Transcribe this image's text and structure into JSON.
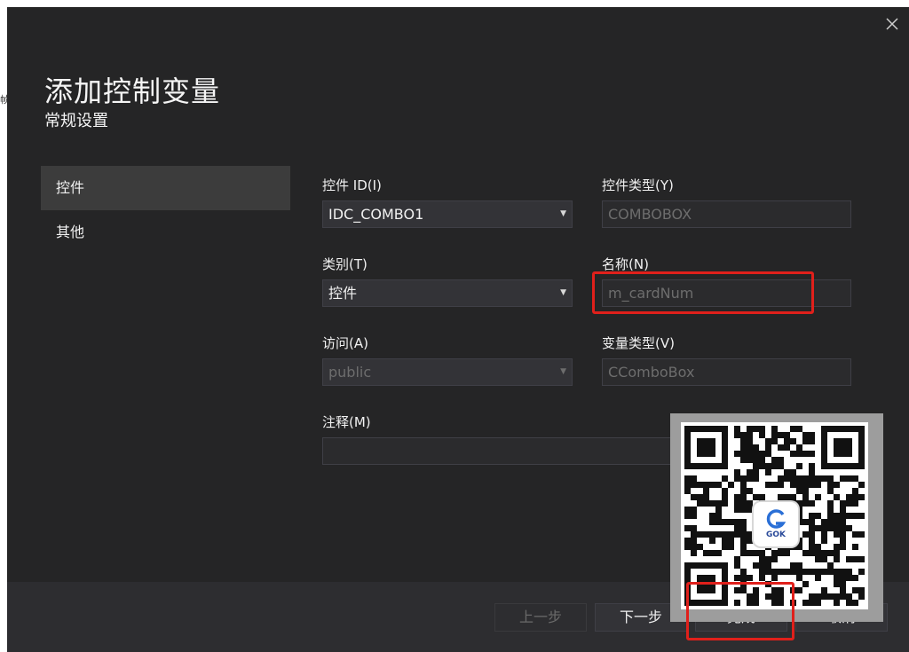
{
  "background": {
    "left_glyph": "帧"
  },
  "dialog": {
    "title": "添加控制变量",
    "subtitle": "常规设置",
    "close_icon": "close-icon"
  },
  "nav": {
    "items": [
      {
        "label": "控件",
        "active": true
      },
      {
        "label": "其他",
        "active": false
      }
    ]
  },
  "form": {
    "control_id": {
      "label": "控件 ID(I)",
      "value": "IDC_COMBO1"
    },
    "control_type": {
      "label": "控件类型(Y)",
      "value": "COMBOBOX"
    },
    "category": {
      "label": "类别(T)",
      "value": "控件"
    },
    "name": {
      "label": "名称(N)",
      "value": "m_cardNum"
    },
    "access": {
      "label": "访问(A)",
      "value": "public"
    },
    "variable_type": {
      "label": "变量类型(V)",
      "value": "CComboBox"
    },
    "comment": {
      "label": "注释(M)",
      "value": ""
    }
  },
  "buttons": {
    "prev": "上一步",
    "next": "下一步",
    "finish": "完成",
    "cancel": "取消"
  },
  "overlay": {
    "qr_logo_text": "GOK"
  },
  "colors": {
    "dialog_bg": "#252526",
    "field_bg": "#333337",
    "active_nav_bg": "#3c3c3c",
    "annotation_red": "#e0201b"
  }
}
